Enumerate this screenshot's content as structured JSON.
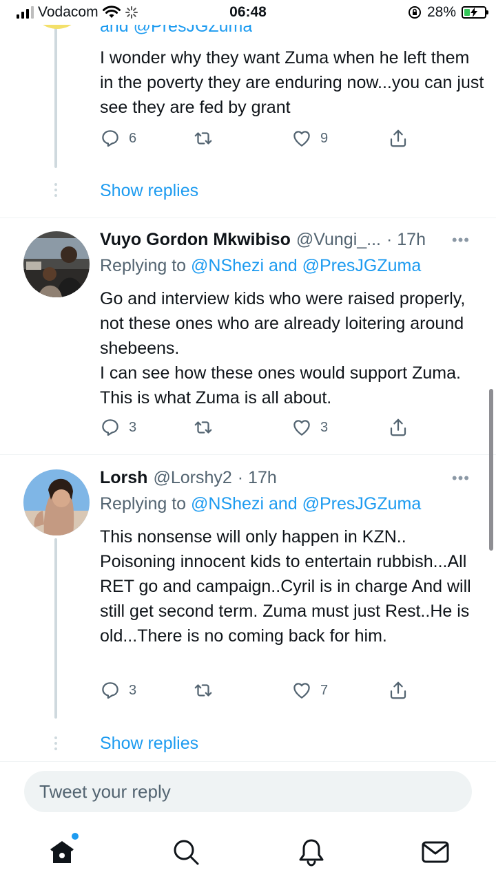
{
  "status_bar": {
    "carrier": "Vodacom",
    "time": "06:48",
    "battery_percent": "28%",
    "battery_level": 0.28,
    "icons": [
      "signal-icon",
      "wifi-icon",
      "loading-icon",
      "orientation-lock-icon",
      "battery-charging-icon"
    ]
  },
  "tweets": [
    {
      "reply_to_partial": "and @PresJGZuma",
      "text": "I wonder why they want Zuma when he left them in the poverty they are enduring now...you can just see they are fed by grant",
      "replies": "6",
      "retweets": "",
      "likes": "9",
      "show_replies": "Show replies"
    },
    {
      "name": "Vuyo Gordon Mkwibiso",
      "handle": "@Vungi_...",
      "time": "· 17h",
      "reply_to_label": "Replying to",
      "reply_to_users": "@NShezi and @PresJGZuma",
      "text_lines": [
        "Go and interview kids who were raised properly, not these ones who are already loitering around shebeens.",
        "I can see how these ones would support Zuma. This is what Zuma is all about."
      ],
      "replies": "3",
      "retweets": "",
      "likes": "3"
    },
    {
      "name": "Lorsh",
      "handle": "@Lorshy2",
      "time": "· 17h",
      "reply_to_label": "Replying to",
      "reply_to_users": "@NShezi and @PresJGZuma",
      "text": "This nonsense will only happen in KZN.. Poisoning innocent kids to entertain rubbish...All RET go and campaign..Cyril is in charge And will still get second term. Zuma must just Rest..He is old...There is no coming back for him.",
      "replies": "3",
      "retweets": "",
      "likes": "7",
      "show_replies": "Show replies"
    }
  ],
  "composer": {
    "placeholder": "Tweet your reply"
  },
  "bottom_nav": {
    "items": [
      "home-icon",
      "search-icon",
      "notifications-icon",
      "messages-icon"
    ]
  },
  "colors": {
    "accent": "#1d9bf0",
    "text_primary": "#0f1419",
    "text_secondary": "#536471",
    "divider": "#eff3f4"
  }
}
